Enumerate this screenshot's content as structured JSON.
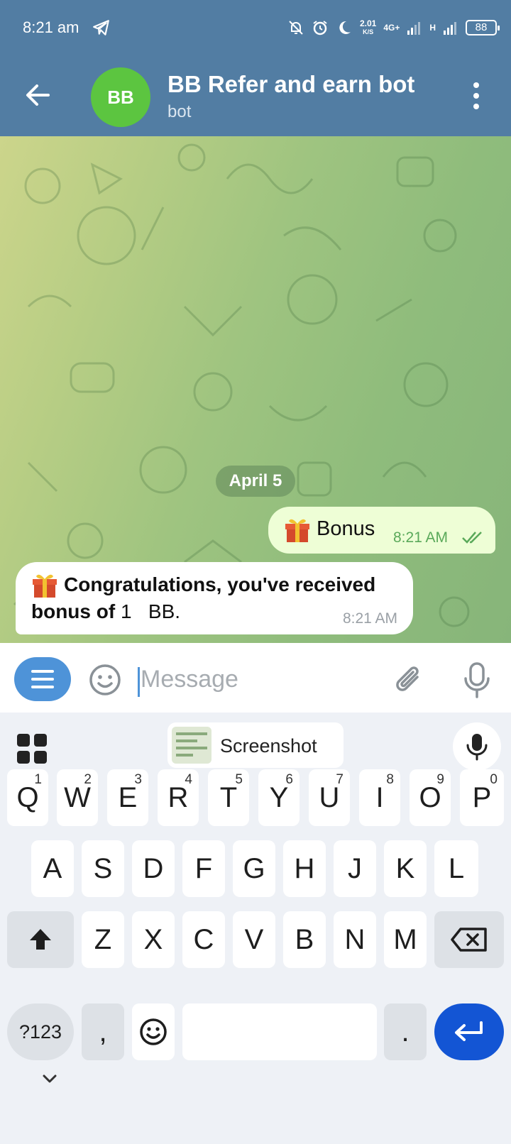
{
  "status_bar": {
    "time": "8:21 am",
    "speed_value": "2.01",
    "speed_unit": "K/S",
    "network_primary": "4G+",
    "network_secondary": "H",
    "battery": "88"
  },
  "header": {
    "avatar_initials": "BB",
    "avatar_color": "#5cc540",
    "title": "BB Refer and earn bot",
    "subtitle": "bot",
    "bar_color": "#527da3"
  },
  "chat": {
    "date_separator": "April 5",
    "messages": [
      {
        "direction": "outgoing",
        "text": "Bonus",
        "time": "8:21 AM",
        "read": true
      },
      {
        "direction": "incoming",
        "text_bold_1": "Congratulations, you've received",
        "text_bold_2": "bonus of",
        "text_regular": " 1   BB.",
        "time": "8:21 AM"
      }
    ]
  },
  "input": {
    "placeholder": "Message",
    "value": ""
  },
  "keyboard": {
    "clipboard_label": "Screenshot",
    "row1": [
      {
        "key": "Q",
        "hint": "1"
      },
      {
        "key": "W",
        "hint": "2"
      },
      {
        "key": "E",
        "hint": "3"
      },
      {
        "key": "R",
        "hint": "4"
      },
      {
        "key": "T",
        "hint": "5"
      },
      {
        "key": "Y",
        "hint": "6"
      },
      {
        "key": "U",
        "hint": "7"
      },
      {
        "key": "I",
        "hint": "8"
      },
      {
        "key": "O",
        "hint": "9"
      },
      {
        "key": "P",
        "hint": "0"
      }
    ],
    "row2": [
      "A",
      "S",
      "D",
      "F",
      "G",
      "H",
      "J",
      "K",
      "L"
    ],
    "row3": [
      "Z",
      "X",
      "C",
      "V",
      "B",
      "N",
      "M"
    ],
    "symbols_label": "?123",
    "comma_label": ",",
    "period_label": ".",
    "enter_color": "#1355d4"
  }
}
